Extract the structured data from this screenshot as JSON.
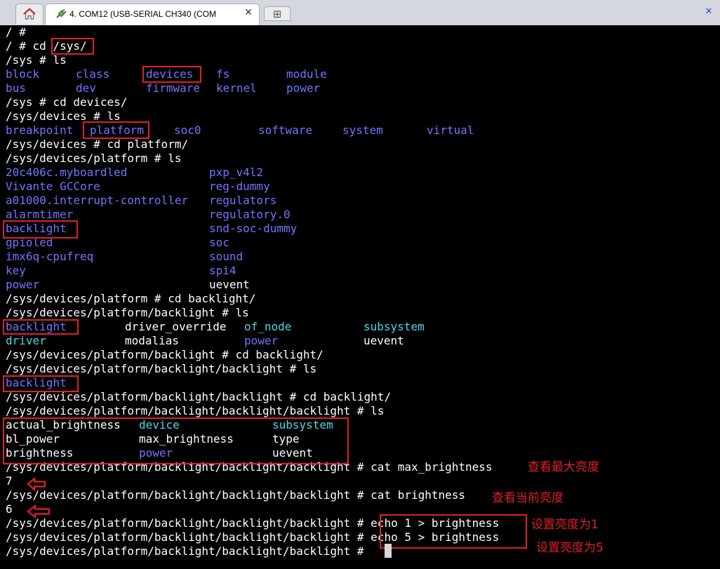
{
  "tabbar": {
    "home_tab_icon": "home-icon",
    "session_tab_icon": "serial-plug-icon",
    "session_tab_title": "4. COM12  (USB-SERIAL CH340 (COM",
    "close_glyph": "✕",
    "new_tab_glyph": "⊞",
    "window_close_glyph": "✕"
  },
  "colors": {
    "background": "#000000",
    "text": "#ffffff",
    "directory": "#7474ff",
    "symlink": "#4ad8e8",
    "annotation": "#e0202a"
  },
  "terminal": {
    "lines": [
      {
        "text": "/ #"
      },
      {
        "text": "/ # cd /sys/"
      },
      {
        "text": "/sys # ls"
      },
      {
        "cells": [
          {
            "text": "block",
            "kind": "dir"
          },
          {
            "text": "class",
            "kind": "dir"
          },
          {
            "text": "devices",
            "kind": "dir"
          },
          {
            "text": "fs",
            "kind": "dir"
          },
          {
            "text": "module",
            "kind": "dir"
          }
        ]
      },
      {
        "cells": [
          {
            "text": "bus",
            "kind": "dir"
          },
          {
            "text": "dev",
            "kind": "dir"
          },
          {
            "text": "firmware",
            "kind": "dir"
          },
          {
            "text": "kernel",
            "kind": "dir"
          },
          {
            "text": "power",
            "kind": "dir"
          }
        ]
      },
      {
        "text": "/sys # cd devices/"
      },
      {
        "text": "/sys/devices # ls"
      },
      {
        "cells": [
          {
            "text": "breakpoint",
            "kind": "dir"
          },
          {
            "text": "platform",
            "kind": "dir"
          },
          {
            "text": "soc0",
            "kind": "dir"
          },
          {
            "text": "software",
            "kind": "dir"
          },
          {
            "text": "system",
            "kind": "dir"
          },
          {
            "text": "virtual",
            "kind": "dir"
          }
        ]
      },
      {
        "text": "/sys/devices # cd platform/"
      },
      {
        "text": "/sys/devices/platform # ls"
      },
      {
        "cells": [
          {
            "text": "20c406c.myboardled",
            "kind": "dir"
          },
          {
            "text": "pxp_v4l2",
            "kind": "dir"
          }
        ]
      },
      {
        "cells": [
          {
            "text": "Vivante GCCore",
            "kind": "dir"
          },
          {
            "text": "reg-dummy",
            "kind": "dir"
          }
        ]
      },
      {
        "cells": [
          {
            "text": "a01000.interrupt-controller",
            "kind": "dir"
          },
          {
            "text": "regulators",
            "kind": "dir"
          }
        ]
      },
      {
        "cells": [
          {
            "text": "alarmtimer",
            "kind": "dir"
          },
          {
            "text": "regulatory.0",
            "kind": "dir"
          }
        ]
      },
      {
        "cells": [
          {
            "text": "backlight",
            "kind": "dir"
          },
          {
            "text": "snd-soc-dummy",
            "kind": "dir"
          }
        ]
      },
      {
        "cells": [
          {
            "text": "gpioled",
            "kind": "dir"
          },
          {
            "text": "soc",
            "kind": "dir"
          }
        ]
      },
      {
        "cells": [
          {
            "text": "imx6q-cpufreq",
            "kind": "dir"
          },
          {
            "text": "sound",
            "kind": "dir"
          }
        ]
      },
      {
        "cells": [
          {
            "text": "key",
            "kind": "dir"
          },
          {
            "text": "spi4",
            "kind": "dir"
          }
        ]
      },
      {
        "cells": [
          {
            "text": "power",
            "kind": "dir"
          },
          {
            "text": "uevent",
            "kind": "plain"
          }
        ]
      },
      {
        "text": "/sys/devices/platform # cd backlight/"
      },
      {
        "text": "/sys/devices/platform/backlight # ls"
      },
      {
        "cells": [
          {
            "text": "backlight",
            "kind": "dir"
          },
          {
            "text": "driver_override",
            "kind": "plain"
          },
          {
            "text": "of_node",
            "kind": "link"
          },
          {
            "text": "subsystem",
            "kind": "link"
          }
        ]
      },
      {
        "cells": [
          {
            "text": "driver",
            "kind": "link"
          },
          {
            "text": "modalias",
            "kind": "plain"
          },
          {
            "text": "power",
            "kind": "dir"
          },
          {
            "text": "uevent",
            "kind": "plain"
          }
        ]
      },
      {
        "text": "/sys/devices/platform/backlight # cd backlight/"
      },
      {
        "text": "/sys/devices/platform/backlight/backlight # ls"
      },
      {
        "cells": [
          {
            "text": "backlight",
            "kind": "dir"
          }
        ]
      },
      {
        "text": "/sys/devices/platform/backlight/backlight # cd backlight/"
      },
      {
        "text": "/sys/devices/platform/backlight/backlight/backlight # ls"
      },
      {
        "cells": [
          {
            "text": "actual_brightness",
            "kind": "plain"
          },
          {
            "text": "device",
            "kind": "link"
          },
          {
            "text": "subsystem",
            "kind": "link"
          }
        ]
      },
      {
        "cells": [
          {
            "text": "bl_power",
            "kind": "plain"
          },
          {
            "text": "max_brightness",
            "kind": "plain"
          },
          {
            "text": "type",
            "kind": "plain"
          }
        ]
      },
      {
        "cells": [
          {
            "text": "brightness",
            "kind": "plain"
          },
          {
            "text": "power",
            "kind": "dir"
          },
          {
            "text": "uevent",
            "kind": "plain"
          }
        ]
      },
      {
        "text": "/sys/devices/platform/backlight/backlight/backlight # cat max_brightness"
      },
      {
        "text": "7"
      },
      {
        "text": "/sys/devices/platform/backlight/backlight/backlight # cat brightness"
      },
      {
        "text": "6"
      },
      {
        "text": "/sys/devices/platform/backlight/backlight/backlight # echo 1 > brightness"
      },
      {
        "text": "/sys/devices/platform/backlight/backlight/backlight # echo 5 > brightness"
      },
      {
        "text": "/sys/devices/platform/backlight/backlight/backlight # "
      }
    ]
  },
  "annotations": {
    "max_brightness_note": "查看最大亮度",
    "current_brightness_note": "查看当前亮度",
    "set_1_note": "设置亮度为1",
    "set_5_note": "设置亮度为5"
  }
}
